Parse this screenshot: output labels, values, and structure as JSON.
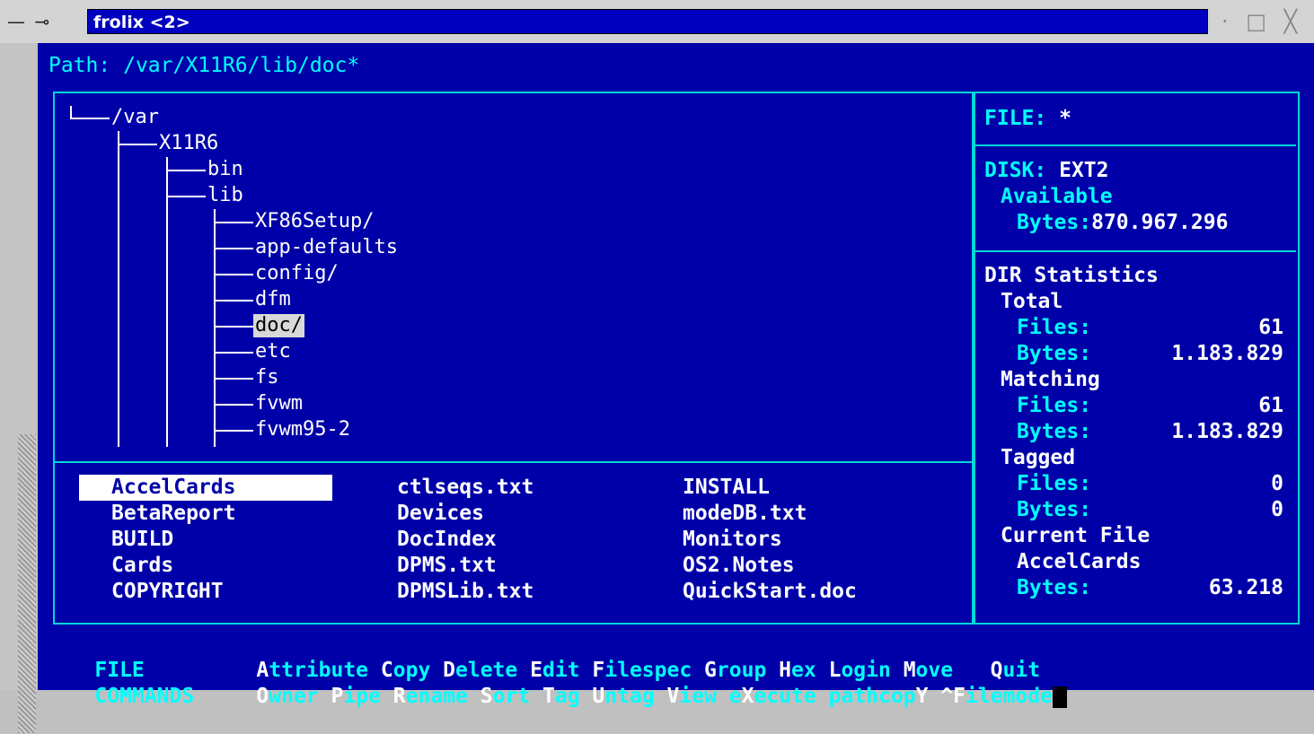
{
  "window": {
    "title": "frolix <2>",
    "left_icons": "— ⊸",
    "right_buttons": "· □ ╳"
  },
  "path": {
    "label": "Path:",
    "value": "/var/X11R6/lib/doc*"
  },
  "tree": {
    "items": [
      "/var",
      "X11R6",
      "bin",
      "lib",
      "XF86Setup/",
      "app-defaults",
      "config/",
      "dfm",
      "doc/",
      "etc",
      "fs",
      "fvwm",
      "fvwm95-2"
    ],
    "selected": "doc/"
  },
  "files": {
    "col1": [
      "AccelCards",
      "BetaReport",
      "BUILD",
      "Cards",
      "COPYRIGHT"
    ],
    "col2": [
      "ctlseqs.txt",
      "Devices",
      "DocIndex",
      "DPMS.txt",
      "DPMSLib.txt"
    ],
    "col3": [
      "INSTALL",
      "modeDB.txt",
      "Monitors",
      "OS2.Notes",
      "QuickStart.doc"
    ],
    "selected": "AccelCards"
  },
  "info": {
    "file_label": "FILE:",
    "file_value": "*",
    "disk_label": "DISK:",
    "disk_value": "EXT2",
    "available": "Available",
    "bytes_label": "Bytes:",
    "available_bytes": "870.967.296",
    "dir_stats": "DIR Statistics",
    "total": "Total",
    "files_label": "Files:",
    "total_files": "61",
    "total_bytes": "1.183.829",
    "matching": "Matching",
    "matching_files": "61",
    "matching_bytes": "1.183.829",
    "tagged": "Tagged",
    "tagged_files": "0",
    "tagged_bytes": "0",
    "current_file": "Current File",
    "current_file_name": "AccelCards",
    "current_file_bytes": "63.218"
  },
  "commands": {
    "row1_label": "FILE",
    "row2_label": "COMMANDS",
    "row1": [
      {
        "hk": "A",
        "rest": "ttribute"
      },
      {
        "hk": "C",
        "rest": "opy"
      },
      {
        "hk": "D",
        "rest": "elete"
      },
      {
        "hk": "E",
        "rest": "dit"
      },
      {
        "hk": "F",
        "rest": "ilespec"
      },
      {
        "hk": "G",
        "rest": "roup"
      },
      {
        "hk": "H",
        "rest": "ex"
      },
      {
        "hk": "L",
        "rest": "ogin"
      },
      {
        "hk": "M",
        "rest": "ove"
      },
      {
        "hk": "Q",
        "rest": "uit"
      }
    ],
    "row2": [
      {
        "hk": "O",
        "rest": "wner"
      },
      {
        "hk": "P",
        "rest": "ipe"
      },
      {
        "hk": "R",
        "rest": "ename"
      },
      {
        "hk": "S",
        "rest": "ort"
      },
      {
        "hk": "T",
        "rest": "ag"
      },
      {
        "hk": "U",
        "rest": "ntag"
      },
      {
        "hk": "V",
        "rest": "iew"
      },
      {
        "pre": "e",
        "hk": "X",
        "rest": "ecute"
      },
      {
        "pre": "pathcop",
        "hk": "Y",
        "rest": ""
      },
      {
        "hk": "^F",
        "rest": "ilemode"
      }
    ]
  },
  "colors": {
    "background": "#0000a8",
    "frame": "#00d8d8",
    "text": "#00ffff",
    "highlight": "#ffffff"
  }
}
